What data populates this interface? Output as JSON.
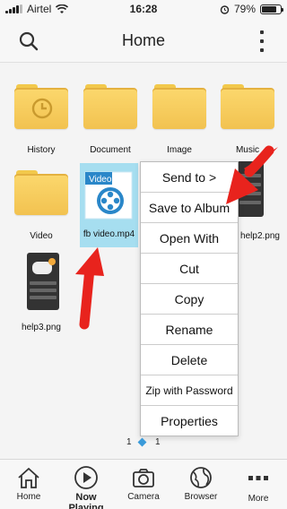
{
  "status_bar": {
    "carrier": "Airtel",
    "time": "16:28",
    "battery": "79%",
    "battery_level": 0.79
  },
  "header": {
    "title": "Home",
    "search_icon": "search-icon",
    "menu_icon": "vertical-dots-icon"
  },
  "files": [
    {
      "name": "History",
      "kind": "folder",
      "icon": "clock-icon"
    },
    {
      "name": "Document",
      "kind": "folder"
    },
    {
      "name": "Image",
      "kind": "folder"
    },
    {
      "name": "Music",
      "kind": "folder"
    },
    {
      "name": "Video",
      "kind": "folder"
    },
    {
      "name": "fb video.mp4",
      "kind": "video",
      "badge": "Video"
    },
    {
      "name": "help2.png",
      "kind": "image"
    },
    {
      "name": "help3.png",
      "kind": "image"
    }
  ],
  "context_menu": {
    "items": [
      "Send to >",
      "Save to Album",
      "Open With",
      "Cut",
      "Copy",
      "Rename",
      "Delete",
      "Zip with Password",
      "Properties"
    ]
  },
  "pager": {
    "current": "1",
    "total": "1"
  },
  "tabbar": {
    "items": [
      {
        "label": "Home",
        "icon": "home-icon"
      },
      {
        "label": "Now Playing",
        "icon": "play-icon",
        "active": true
      },
      {
        "label": "Camera",
        "icon": "camera-icon"
      },
      {
        "label": "Browser",
        "icon": "browser-icon"
      },
      {
        "label": "More",
        "icon": "more-dots-icon"
      }
    ]
  },
  "colors": {
    "arrow": "#e8231d",
    "selection": "#a6def0",
    "pager_dot": "#3a9ad9",
    "folder": "#f2c250"
  }
}
